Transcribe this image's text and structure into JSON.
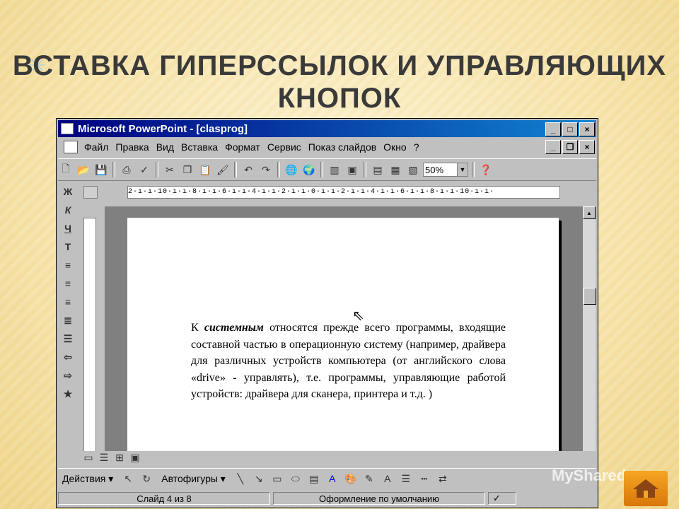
{
  "slide": {
    "title": "Вставка гиперссылок и управляющих кнопок"
  },
  "window": {
    "title": "Microsoft PowerPoint - [clasprog]",
    "controls": [
      "_",
      "□",
      "×"
    ],
    "doc_controls": [
      "_",
      "❐",
      "×"
    ]
  },
  "menu": {
    "items": [
      "Файл",
      "Правка",
      "Вид",
      "Вставка",
      "Формат",
      "Сервис",
      "Показ слайдов",
      "Окно",
      "?"
    ]
  },
  "toolbar": {
    "zoom": "50%"
  },
  "format_tools": {
    "bold": "Ж",
    "italic": "К",
    "underline": "Ч",
    "shadow": "Т"
  },
  "ruler": {
    "text": "2·ı·ı·10·ı·ı·8·ı·ı·6·ı·ı·4·ı·ı·2·ı·ı·0·ı·ı·2·ı·ı·4·ı·ı·6·ı·ı·8·ı·ı·10·ı·ı·"
  },
  "document": {
    "para_start": "К ",
    "para_em": "системным",
    "para_rest": " относятся прежде всего программы, входящие составной частью в операционную систему (например, драйвера для различных устройств компьютера (от английского слова «drive» - управлять), т.е. программы, управляющие работой устройств: драйвера для сканера, принтера и т.д. )"
  },
  "drawing": {
    "actions": "Действия ▾",
    "autoshapes": "Автофигуры ▾"
  },
  "status": {
    "slide": "Слайд 4 из 8",
    "design": "Оформление по умолчанию"
  },
  "watermark": "MyShared"
}
